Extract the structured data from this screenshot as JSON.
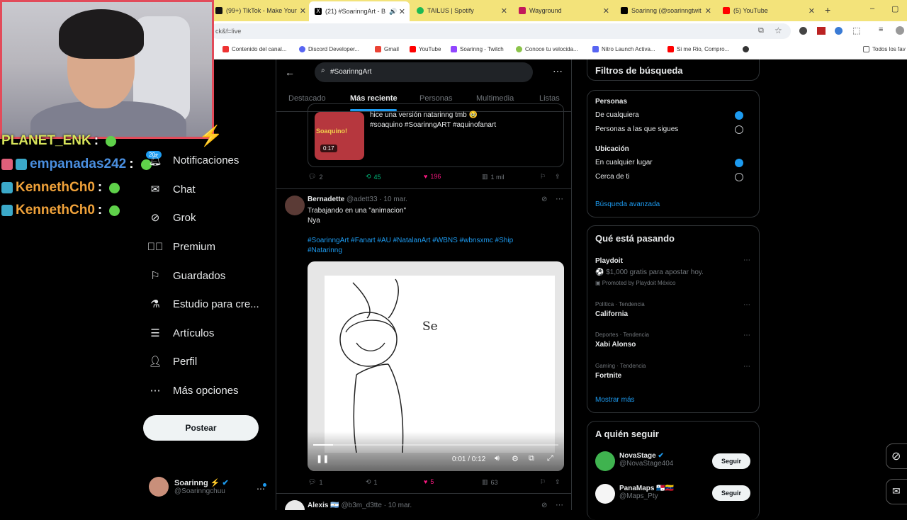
{
  "browser": {
    "tabs": [
      {
        "label": "(99+) TikTok - Make Your",
        "color": "#111"
      },
      {
        "label": "(21) #SoarinngArt - B",
        "color": "#000"
      },
      {
        "label": "TAILUS | Spotify",
        "color": "#1db954"
      },
      {
        "label": "Wayground",
        "color": "#c2185b"
      },
      {
        "label": "Soarinng (@soarinngtwit",
        "color": "#000"
      },
      {
        "label": "(5) YouTube",
        "color": "#ff0000"
      }
    ],
    "url": "ck&f=live",
    "bookmarks": [
      {
        "label": "Contenido del canal...",
        "color": "#e33"
      },
      {
        "label": "Discord Developer...",
        "color": "#5865f2"
      },
      {
        "label": "Gmail",
        "color": "#ea4335"
      },
      {
        "label": "YouTube",
        "color": "#ff0000"
      },
      {
        "label": "Soarinng - Twitch",
        "color": "#9146ff"
      },
      {
        "label": "Conoce tu velocida...",
        "color": "#8bc34a"
      },
      {
        "label": "Nitro Launch Activa...",
        "color": "#5865f2"
      },
      {
        "label": "Si me Rio, Compro...",
        "color": "#ff0000"
      },
      {
        "label": "Todos los fav",
        "color": "#666"
      }
    ]
  },
  "stream_chat": {
    "lines": [
      {
        "user": "PLANET_ENK",
        "color": "#d7e35a"
      },
      {
        "user": "empanadas242",
        "color": "#4a8fe0"
      },
      {
        "user": "KennethCh0",
        "color": "#f0a23a"
      },
      {
        "user": "KennethCh0",
        "color": "#f0a23a"
      }
    ]
  },
  "nav": {
    "notifications_badge": "20+",
    "items": [
      "Notificaciones",
      "Chat",
      "Grok",
      "Premium",
      "Guardados",
      "Estudio para cre...",
      "Artículos",
      "Perfil",
      "Más opciones"
    ],
    "post_label": "Postear",
    "account_name": "Soarinng ⚡",
    "account_handle": "@Soarinngchuu"
  },
  "search": {
    "query": "#SoarinngArt",
    "tabs": [
      "Destacado",
      "Más reciente",
      "Personas",
      "Multimedia",
      "Listas"
    ]
  },
  "tweet1": {
    "text_line1": "hice una versión natarinng tmb 🥹",
    "text_line2": "#soaquino #SoarinngART #aquinofanart",
    "thumb_title": "Soaquino!",
    "thumb_duration": "0:17",
    "replies": "2",
    "retweets": "45",
    "likes": "196",
    "views": "1 mil"
  },
  "tweet2": {
    "name": "Bernadette",
    "handle_date": "@adett33 · 10 mar.",
    "line1": "Trabajando en una \"animacion\"",
    "line2": "Nya",
    "hashtags1": "#SoarinngArt #Fanart #AU #NatalanArt #WBNS #wbnsxmc #Ship",
    "hashtags2": "#Natarinng",
    "video_text": "Se",
    "video_time": "0:01 / 0:12",
    "replies": "1",
    "retweets": "1",
    "likes": "5",
    "views": "63"
  },
  "tweet3": {
    "name": "Alexis 🇦🇷",
    "handle_date": "@b3m_d3tte · 10 mar."
  },
  "filters": {
    "title": "Filtros de búsqueda",
    "people_heading": "Personas",
    "people_opt1": "De cualquiera",
    "people_opt2": "Personas a las que sigues",
    "location_heading": "Ubicación",
    "location_opt1": "En cualquier lugar",
    "location_opt2": "Cerca de ti",
    "advanced": "Búsqueda avanzada"
  },
  "trends": {
    "title": "Qué está pasando",
    "promo_name": "Playdoit",
    "promo_text": "⚽ $1,000 gratis para apostar hoy.",
    "promo_by": "Promoted by Playdoit México",
    "items": [
      {
        "category": "Política · Tendencia",
        "name": "California"
      },
      {
        "category": "Deportes · Tendencia",
        "name": "Xabi Alonso"
      },
      {
        "category": "Gaming · Tendencia",
        "name": "Fortnite"
      }
    ],
    "show_more": "Mostrar más"
  },
  "who_to_follow": {
    "title": "A quién seguir",
    "follow_label": "Seguir",
    "accounts": [
      {
        "name": "NovaStage",
        "handle": "@NovaStage404"
      },
      {
        "name": "PanaMaps 🇵🇦🇻🇪",
        "handle": "@Maps_Pty"
      }
    ]
  }
}
